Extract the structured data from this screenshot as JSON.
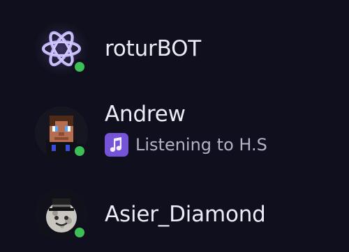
{
  "members": [
    {
      "name": "roturBOT",
      "status": "online",
      "avatar_icon": "atom-icon",
      "activity": null
    },
    {
      "name": "Andrew",
      "status": "online",
      "avatar_icon": "minecraft-avatar-icon",
      "activity": {
        "icon": "music-note-icon",
        "text": "Listening to H.S"
      }
    },
    {
      "name": "Asier_Diamond",
      "status": "online",
      "avatar_icon": "moon-top-hat-avatar-icon",
      "activity": null
    }
  ],
  "colors": {
    "background": "#0f0f1e",
    "online": "#3ebf55",
    "text": "#ececf5",
    "subtext": "#b3b3c7",
    "music_icon": "#7554d8"
  }
}
